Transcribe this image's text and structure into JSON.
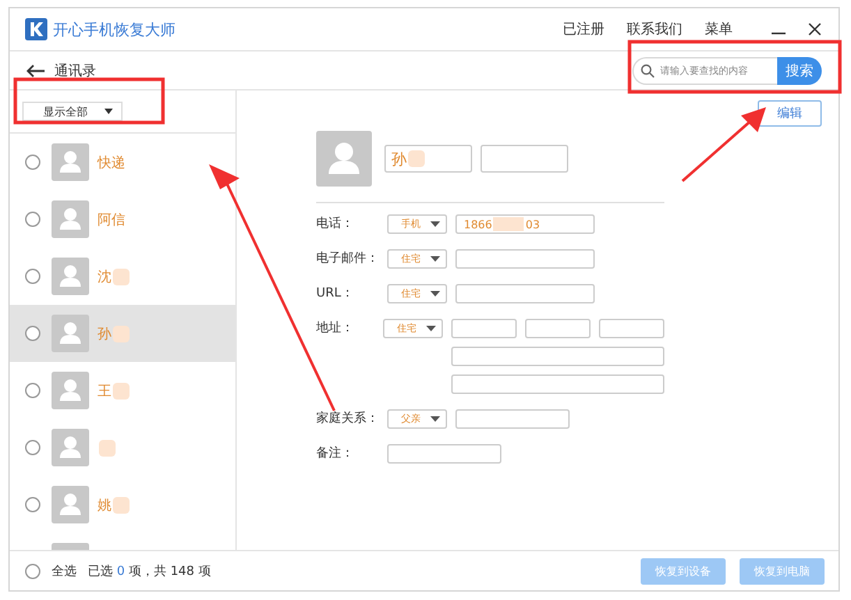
{
  "window": {
    "title": "开心手机恢复大师",
    "menu": [
      "已注册",
      "联系我们",
      "菜单"
    ]
  },
  "header": {
    "back_label": "通讯录",
    "search": {
      "placeholder": "请输入要查找的内容",
      "button": "搜索"
    }
  },
  "filter": {
    "value": "显示全部"
  },
  "contacts": [
    {
      "name": "快递",
      "blurred": false,
      "checked": false,
      "selected": false
    },
    {
      "name": "阿信",
      "blurred": false,
      "checked": false,
      "selected": false
    },
    {
      "name": "沈",
      "blurred": true,
      "checked": false,
      "selected": false
    },
    {
      "name": "孙",
      "blurred": true,
      "checked": false,
      "selected": true
    },
    {
      "name": "王",
      "blurred": true,
      "checked": false,
      "selected": false
    },
    {
      "blurred": true,
      "checked": false,
      "selected": false
    },
    {
      "name": "姚",
      "blurred": true,
      "checked": false,
      "selected": false
    },
    {
      "selected": false
    }
  ],
  "detail": {
    "edit": "编辑",
    "name": "孙",
    "fields": [
      {
        "kind": "phone",
        "label": "电话：",
        "type": "手机",
        "value_start": "1866",
        "value_end": "03"
      },
      {
        "kind": "single",
        "label": "电子邮件：",
        "type": "住宅"
      },
      {
        "kind": "single",
        "label": "URL：",
        "type": "住宅"
      },
      {
        "kind": "address",
        "label": "地址：",
        "type": "住宅"
      },
      {
        "kind": "single",
        "label": "家庭关系：",
        "type": "父亲"
      },
      {
        "kind": "note",
        "label": "备注："
      }
    ]
  },
  "footer": {
    "all_checked": false,
    "select_all": "全选",
    "selected_prefix": "已选",
    "selected_count": "0",
    "selected_suffix": "项，共 148 项",
    "buttons": [
      {
        "label": "恢复到设备",
        "disabled": true
      },
      {
        "label": "恢复到电脑",
        "disabled": true
      }
    ]
  }
}
